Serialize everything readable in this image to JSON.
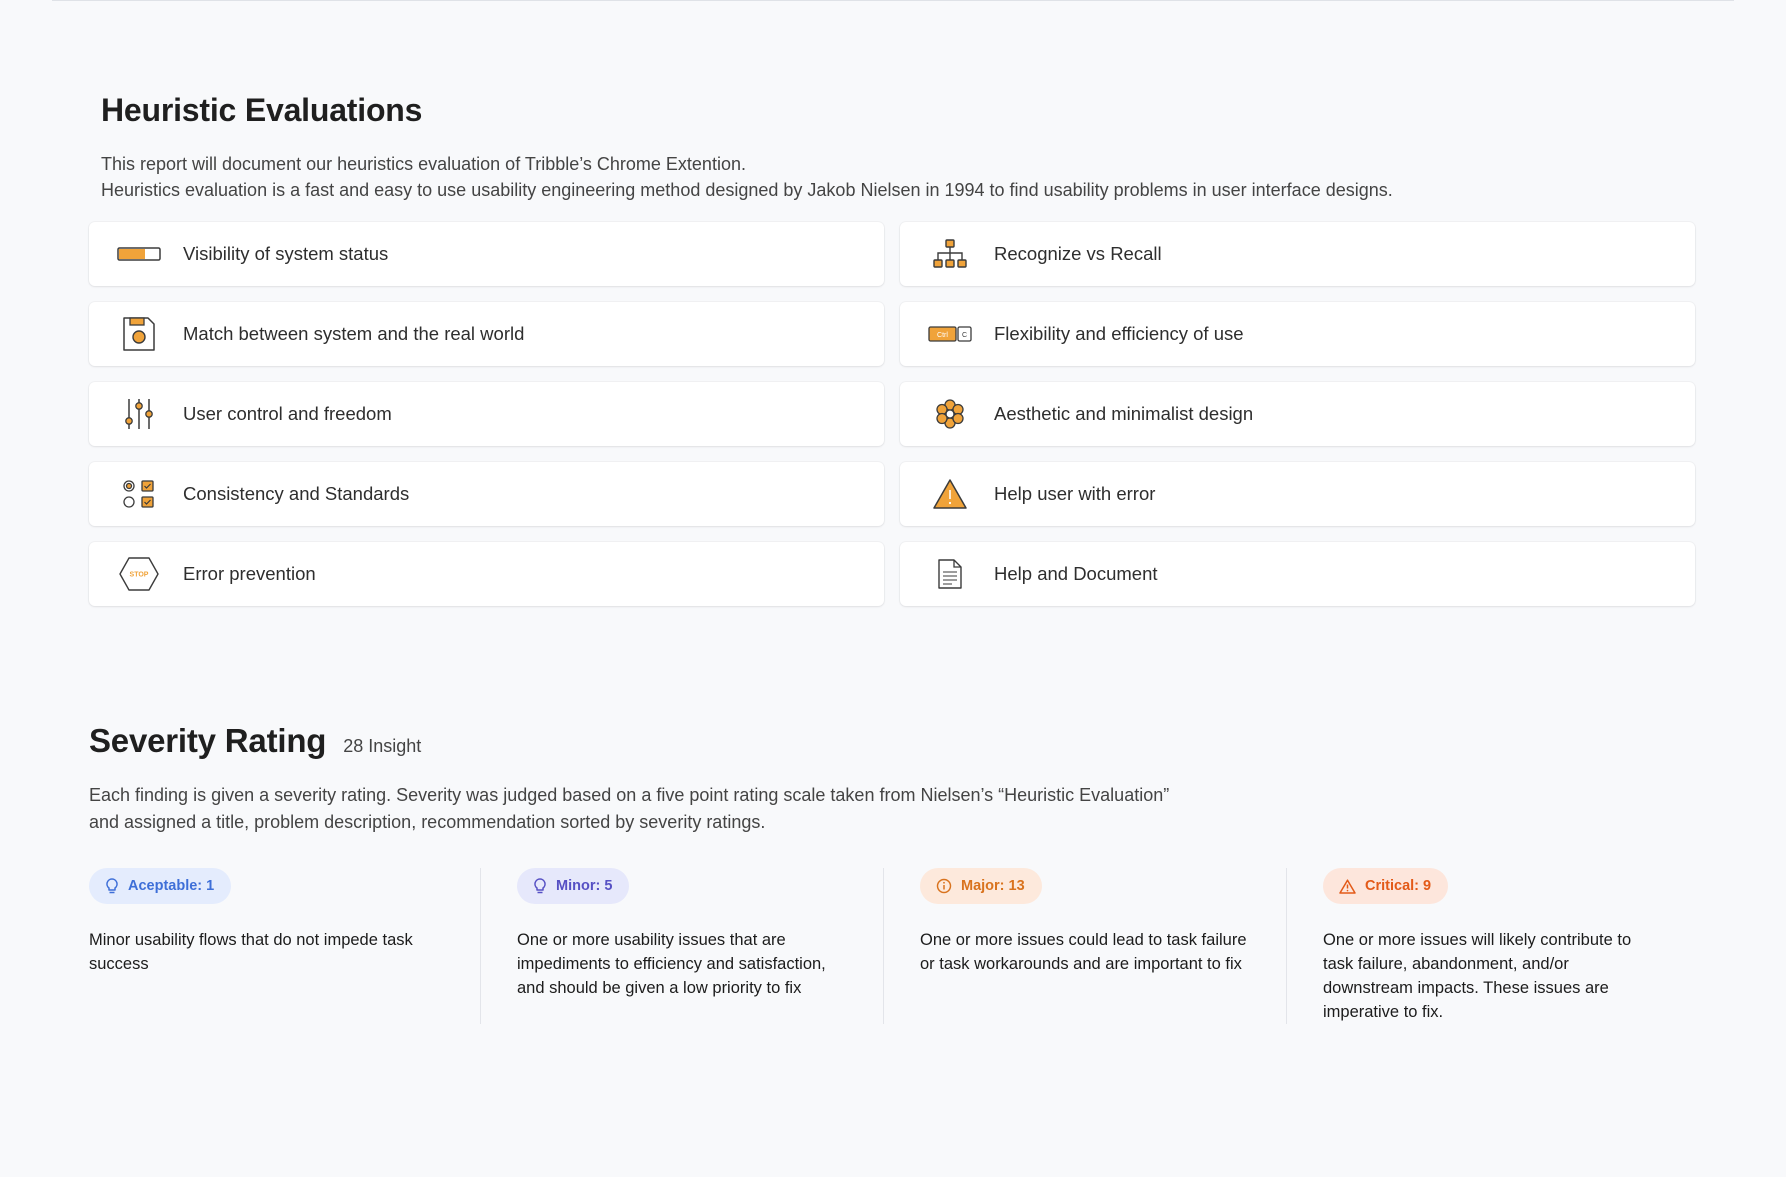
{
  "heuristics": {
    "title": "Heuristic Evaluations",
    "intro_line1": "This report will document our heuristics evaluation of Tribble’s Chrome Extention.",
    "intro_line2": "Heuristics evaluation is a fast and easy to use usability engineering method designed by Jakob Nielsen in 1994 to find usability problems in user interface designs.",
    "items": [
      {
        "label": "Visibility of system status",
        "icon": "progress-bar-icon"
      },
      {
        "label": "Recognize vs Recall",
        "icon": "sitemap-icon"
      },
      {
        "label": "Match between system and the real world",
        "icon": "floppy-disk-icon"
      },
      {
        "label": "Flexibility and efficiency of use",
        "icon": "keyboard-shortcut-icon",
        "icon_keys": [
          "Ctrl",
          "C"
        ]
      },
      {
        "label": "User control and freedom",
        "icon": "sliders-icon"
      },
      {
        "label": "Aesthetic and minimalist design",
        "icon": "flower-icon"
      },
      {
        "label": "Consistency and Standards",
        "icon": "form-controls-icon"
      },
      {
        "label": "Help user with error",
        "icon": "warning-triangle-icon"
      },
      {
        "label": "Error prevention",
        "icon": "stop-sign-icon",
        "icon_text": "STOP"
      },
      {
        "label": "Help and Document",
        "icon": "document-icon"
      }
    ],
    "accent_color": "#f0a33a"
  },
  "severity": {
    "title": "Severity Rating",
    "count": "28 Insight",
    "desc_line1": "Each finding is given a severity rating. Severity was judged based on a five point rating scale taken from Nielsen’s “Heuristic Evaluation”",
    "desc_line2": "and assigned a title, problem description, recommendation sorted by severity ratings.",
    "levels": [
      {
        "badge": "Aceptable: 1",
        "icon": "lightbulb-icon",
        "color": "#3e6fd8",
        "text": "Minor usability flows that do not impede task success"
      },
      {
        "badge": "Minor: 5",
        "icon": "lightbulb-icon",
        "color": "#5650c4",
        "text": "One or more usability issues that are impediments to efficiency and satisfaction, and should be given a low priority to fix"
      },
      {
        "badge": "Major: 13",
        "icon": "info-circle-icon",
        "color": "#d9731e",
        "text": "One or more issues could lead to task failure or task workarounds and are important to fix"
      },
      {
        "badge": "Critical: 9",
        "icon": "alert-triangle-icon",
        "color": "#e35a18",
        "text": "One or more issues will likely contribute to task failure, abandonment, and/or downstream impacts. These issues are imperative to fix."
      }
    ]
  }
}
